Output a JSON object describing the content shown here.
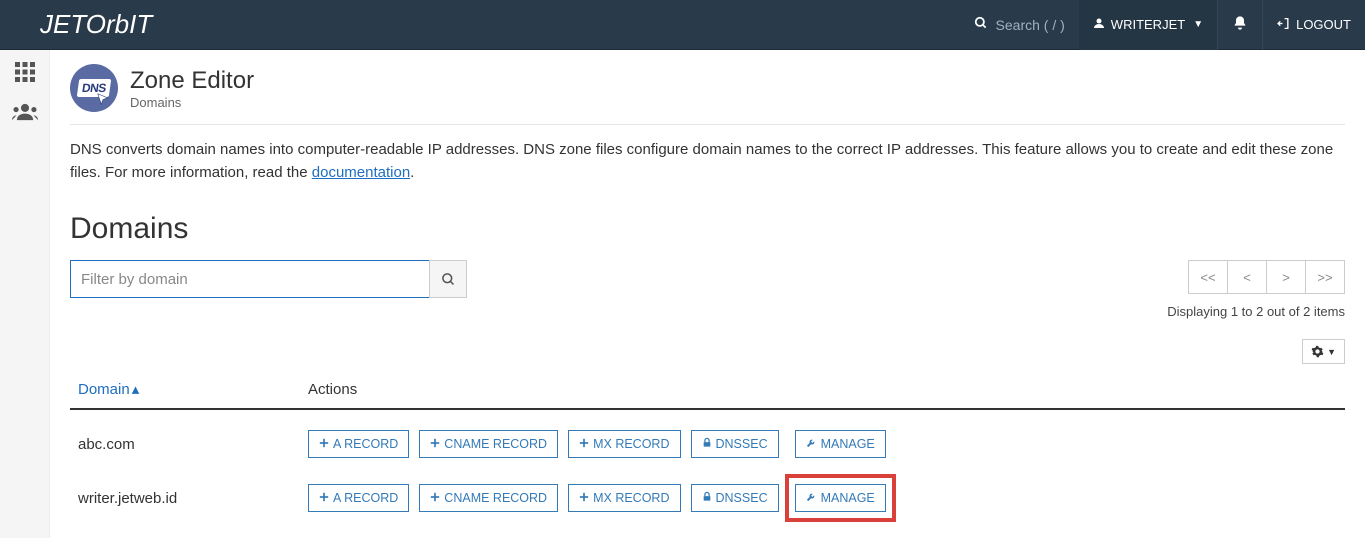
{
  "brand": "JETORBIT",
  "top": {
    "search_placeholder": "Search ( / )",
    "user_label": "WRITERJET",
    "logout_label": "LOGOUT"
  },
  "page": {
    "title": "Zone Editor",
    "category": "Domains",
    "intro": "DNS converts domain names into computer-readable IP addresses. DNS zone files configure domain names to the correct IP addresses. This feature allows you to create and edit these zone files. For more information, read the ",
    "doc_link": "documentation",
    "intro_suffix": "."
  },
  "domains_heading": "Domains",
  "filter": {
    "placeholder": "Filter by domain"
  },
  "pager": {
    "first": "<<",
    "prev": "<",
    "next": ">",
    "last": ">>",
    "status": "Displaying 1 to 2 out of 2 items"
  },
  "table": {
    "col_domain": "Domain",
    "col_actions": "Actions",
    "buttons": {
      "a": "A RECORD",
      "cname": "CNAME RECORD",
      "mx": "MX RECORD",
      "dnssec": "DNSSEC",
      "manage": "MANAGE"
    },
    "rows": [
      {
        "domain": "abc.com",
        "highlight_manage": false
      },
      {
        "domain": "writer.jetweb.id",
        "highlight_manage": true
      }
    ]
  }
}
